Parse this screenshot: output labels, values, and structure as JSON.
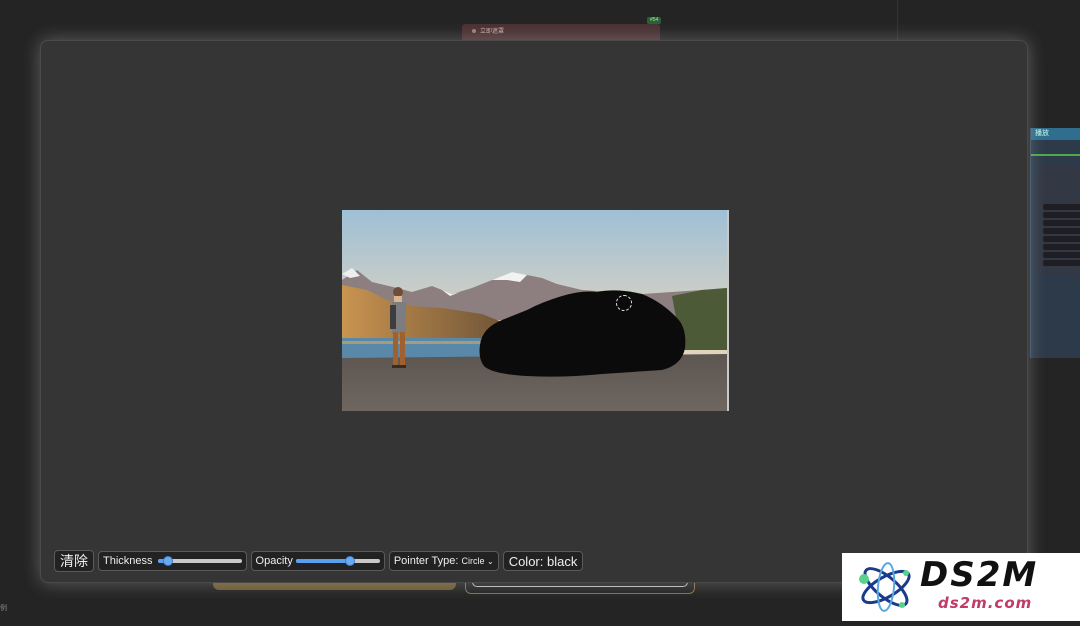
{
  "background_graph": {
    "top_node_title": "立即遮罩",
    "top_badge": "#54",
    "right_panel_title": "播放",
    "bottom_left_text": "例"
  },
  "mask_editor": {
    "clear_label": "清除",
    "thickness_label": "Thickness",
    "thickness_value": 0.12,
    "opacity_label": "Opacity",
    "opacity_value": 0.65,
    "pointer_type_label": "Pointer Type:",
    "pointer_type_value": "Circle",
    "color_label": "Color: black",
    "slider_color": "#5aa0ef"
  },
  "logo": {
    "main_text": "DS2M",
    "sub_text": "ds2m.com",
    "accent_color": "#c03a6a"
  }
}
